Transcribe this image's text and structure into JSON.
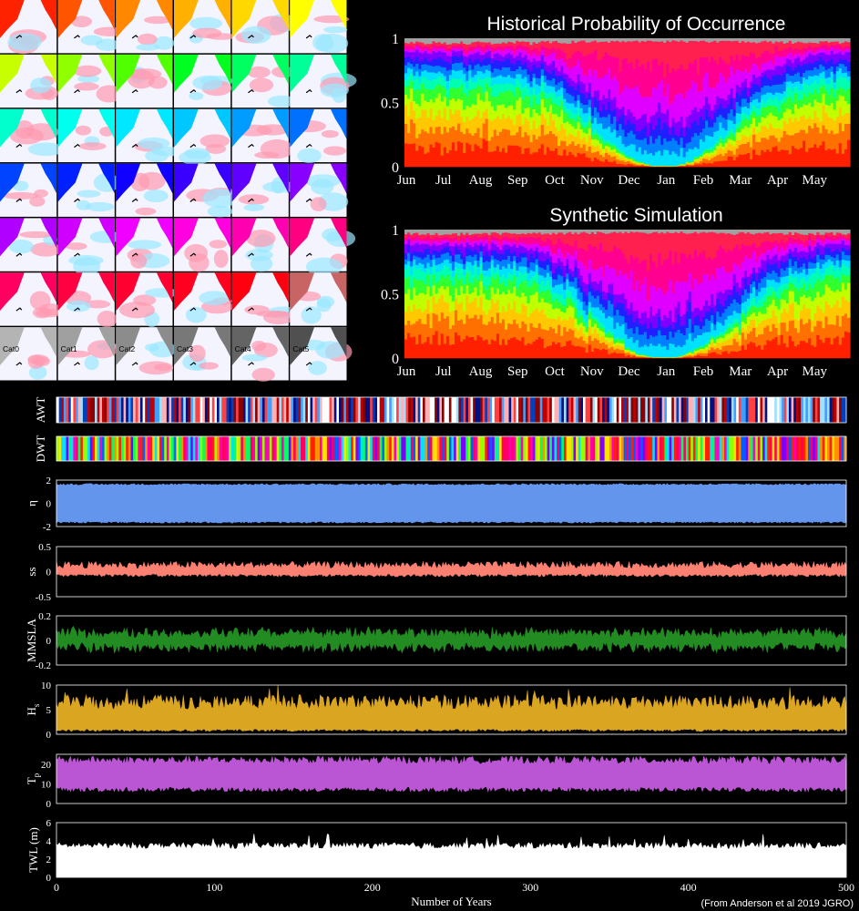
{
  "chart_data": [
    {
      "type": "heatmap",
      "description_grid": "map-panels",
      "rows": 7,
      "cols": 6,
      "panel_labels": [
        "Cat0",
        "Cat1",
        "Cat2",
        "Cat3",
        "Cat4",
        "Cat5"
      ],
      "row_colors": [
        [
          "#ff2200",
          "#ff5500",
          "#ff8800",
          "#ffb000",
          "#ffd800",
          "#ffff00"
        ],
        [
          "#c8ff00",
          "#90ff00",
          "#50ff00",
          "#00ff20",
          "#00ff60",
          "#00ff99"
        ],
        [
          "#00ffcc",
          "#00ffee",
          "#00e8ff",
          "#00c8ff",
          "#009cff",
          "#0070ff"
        ],
        [
          "#0044ff",
          "#0020ff",
          "#1000ff",
          "#3a00ff",
          "#6000ff",
          "#8800ff"
        ],
        [
          "#b000ff",
          "#d000ff",
          "#f000ff",
          "#ff00e0",
          "#ff00b0",
          "#ff0080"
        ],
        [
          "#ff0060",
          "#ff0040",
          "#ff0030",
          "#ff0020",
          "#ff0010",
          "#c86464"
        ],
        [
          "#b4b4b4",
          "#a0a0a0",
          "#8c8c8c",
          "#787878",
          "#646464",
          "#505050"
        ]
      ]
    },
    {
      "type": "area",
      "title": "Historical Probability of Occurrence",
      "x_ticks": [
        "Jun",
        "Jul",
        "Aug",
        "Sep",
        "Oct",
        "Nov",
        "Dec",
        "Jan",
        "Feb",
        "Mar",
        "Apr",
        "May"
      ],
      "yticks": [
        "0",
        "0.5",
        "1"
      ],
      "ylim": [
        0,
        1
      ],
      "stacked": true,
      "layer_colors": [
        "#ff2000",
        "#ff7000",
        "#ffc800",
        "#c0ff00",
        "#30ff30",
        "#00ffb0",
        "#00e0ff",
        "#0080ff",
        "#2020ff",
        "#8000ff",
        "#e000ff",
        "#ff0090",
        "#ff2050",
        "#a0a0a0"
      ]
    },
    {
      "type": "area",
      "title": "Synthetic Simulation",
      "x_ticks": [
        "Jun",
        "Jul",
        "Aug",
        "Sep",
        "Oct",
        "Nov",
        "Dec",
        "Jan",
        "Feb",
        "Mar",
        "Apr",
        "May"
      ],
      "yticks": [
        "0",
        "0.5",
        "1"
      ],
      "ylim": [
        0,
        1
      ],
      "stacked": true
    },
    {
      "type": "line",
      "xlabel": "Number of Years",
      "xlim": [
        0,
        500
      ],
      "x_ticks": [
        "0",
        "100",
        "200",
        "300",
        "400",
        "500"
      ],
      "panels": [
        {
          "ylabel": "AWT",
          "kind": "stripes",
          "palette": [
            "#8b0000",
            "#c00000",
            "#ff4040",
            "#ffb0b0",
            "#ffffff",
            "#a0e0ff",
            "#40a0ff",
            "#0040c0",
            "#001080"
          ]
        },
        {
          "ylabel": "DWT",
          "kind": "stripes",
          "palette": [
            "#ff2000",
            "#ff9000",
            "#ffe000",
            "#90ff00",
            "#00ff60",
            "#00e0ff",
            "#0060ff",
            "#8000ff",
            "#ff00c0",
            "#ff0060"
          ]
        },
        {
          "ylabel": "η",
          "color": "#6495ed",
          "ylim": [
            -2,
            2
          ],
          "yticks": [
            "-2",
            "0",
            "2"
          ]
        },
        {
          "ylabel": "ss",
          "color": "#fa8072",
          "ylim": [
            -0.5,
            0.5
          ],
          "yticks": [
            "-0.5",
            "0",
            "0.5"
          ]
        },
        {
          "ylabel": "MMSLA",
          "color": "#228b22",
          "ylim": [
            -0.2,
            0.2
          ],
          "yticks": [
            "-0.2",
            "0",
            "0.2"
          ]
        },
        {
          "ylabel": "H",
          "ylabel_sub": "s",
          "color": "#daa520",
          "ylim": [
            0,
            10
          ],
          "yticks": [
            "0",
            "5",
            "10"
          ]
        },
        {
          "ylabel": "T",
          "ylabel_sub": "p",
          "color": "#ba55d3",
          "ylim": [
            0,
            25
          ],
          "yticks": [
            "0",
            "10",
            "20"
          ]
        },
        {
          "ylabel": "TWL (m)",
          "color": "#ffffff",
          "ylim": [
            0,
            6
          ],
          "yticks": [
            "0",
            "2",
            "4",
            "6"
          ]
        }
      ]
    }
  ],
  "credit": "(From Anderson et al 2019 JGRO)"
}
